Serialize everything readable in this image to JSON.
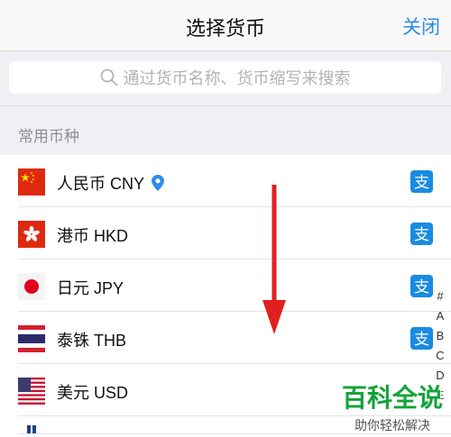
{
  "header": {
    "title": "选择货币",
    "close_label": "关闭"
  },
  "search": {
    "placeholder": "通过货币名称、货币缩写来搜索"
  },
  "section": {
    "label": "常用币种"
  },
  "currencies": [
    {
      "label": "人民币 CNY",
      "flag": "china-flag",
      "has_location": true
    },
    {
      "label": "港币 HKD",
      "flag": "hongkong-flag"
    },
    {
      "label": "日元 JPY",
      "flag": "japan-flag"
    },
    {
      "label": "泰铢 THB",
      "flag": "thailand-flag"
    },
    {
      "label": "美元 USD",
      "flag": "usa-flag"
    }
  ],
  "alipay_icon_glyph": "支",
  "index_letters": [
    "#",
    "A",
    "B",
    "C",
    "D",
    "E"
  ],
  "colors": {
    "accent": "#2a8de8",
    "alipay": "#1a8be0",
    "annotation_arrow": "#e02020",
    "watermark": "#12a33a"
  },
  "watermark": {
    "main": "百科全说",
    "sub": "助你轻松解决"
  }
}
